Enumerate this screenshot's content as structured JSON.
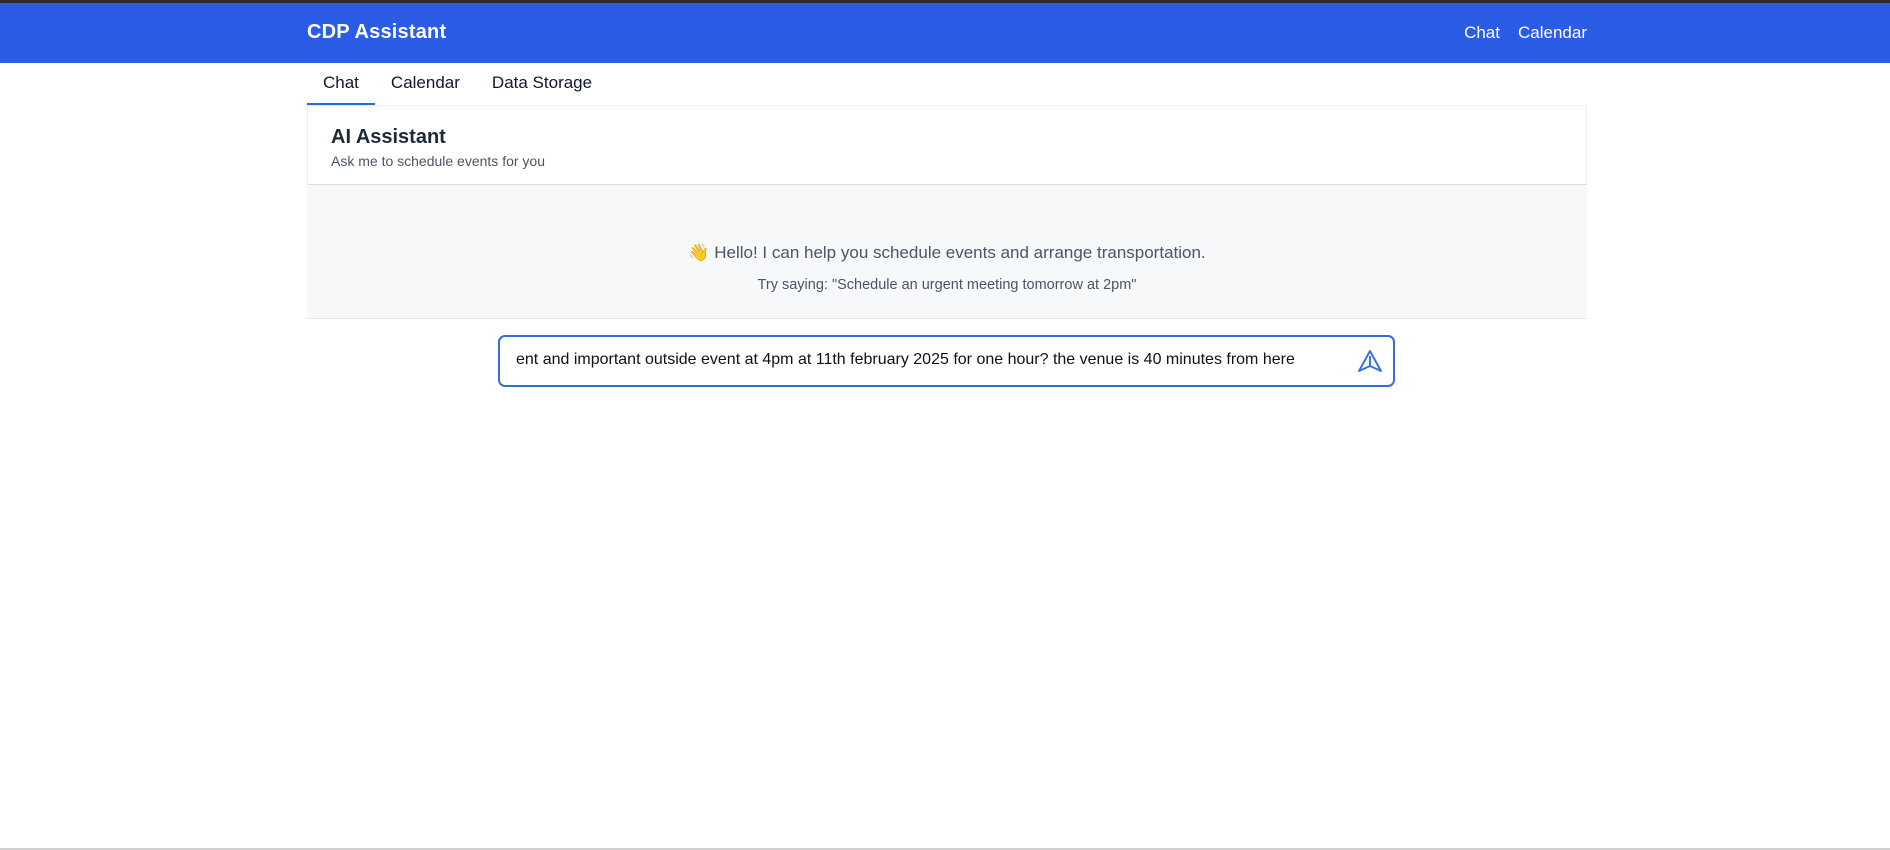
{
  "navbar": {
    "brand": "CDP Assistant",
    "links": [
      "Chat",
      "Calendar"
    ],
    "background_color": "#2b5ce6"
  },
  "tabs": [
    {
      "label": "Chat",
      "active": true
    },
    {
      "label": "Calendar",
      "active": false
    },
    {
      "label": "Data Storage",
      "active": false
    }
  ],
  "assistant": {
    "title": "AI Assistant",
    "subtitle": "Ask me to schedule events for you"
  },
  "messages": {
    "greeting_icon": "waving-hand",
    "greeting_emoji": "👋",
    "greeting": "Hello! I can help you schedule events and arrange transportation.",
    "hint": "Try saying: \"Schedule an urgent meeting tomorrow at 2pm\""
  },
  "input": {
    "value": "ent and important outside event at 4pm at 11th february 2025 for one hour? the venue is 40 minutes from here",
    "send_icon": "send-icon",
    "accent_color": "#2f6fd6"
  }
}
